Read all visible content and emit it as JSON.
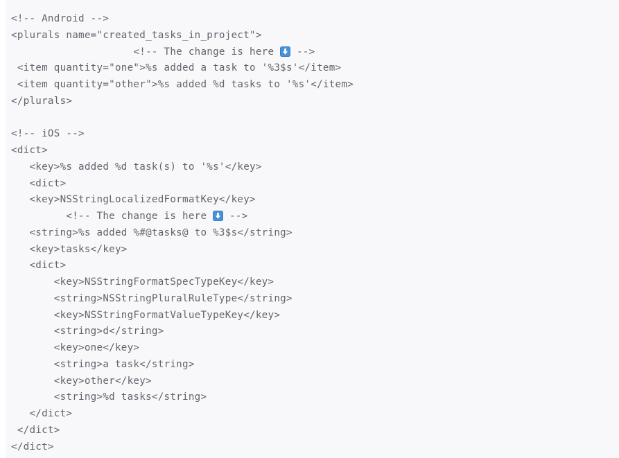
{
  "code": {
    "language": "xml",
    "background_color": "#f8f7fa",
    "text_color": "#60656d",
    "icon": {
      "name": "down-arrow-icon",
      "glyph": "⬇️",
      "background_color": "#4a90d9",
      "arrow_color": "#ffffff"
    },
    "lines": [
      {
        "id": "l1",
        "text": "<!-- Android -->"
      },
      {
        "id": "l2",
        "text": "<plurals name=\"created_tasks_in_project\">"
      },
      {
        "id": "l3",
        "before": "                    <!-- The change is here ",
        "icon": true,
        "after": " -->"
      },
      {
        "id": "l4",
        "text": " <item quantity=\"one\">%s added a task to '%3$s'</item>"
      },
      {
        "id": "l5",
        "text": " <item quantity=\"other\">%s added %d tasks to '%s'</item>"
      },
      {
        "id": "l6",
        "text": "</plurals>"
      },
      {
        "id": "l7",
        "text": ""
      },
      {
        "id": "l8",
        "text": "<!-- iOS -->"
      },
      {
        "id": "l9",
        "text": "<dict>"
      },
      {
        "id": "l10",
        "text": "   <key>%s added %d task(s) to '%s'</key>"
      },
      {
        "id": "l11",
        "text": "   <dict>"
      },
      {
        "id": "l12",
        "text": "   <key>NSStringLocalizedFormatKey</key>"
      },
      {
        "id": "l13",
        "before": "         <!-- The change is here ",
        "icon": true,
        "after": " -->"
      },
      {
        "id": "l14",
        "text": "   <string>%s added %#@tasks@ to %3$s</string>"
      },
      {
        "id": "l15",
        "text": "   <key>tasks</key>"
      },
      {
        "id": "l16",
        "text": "   <dict>"
      },
      {
        "id": "l17",
        "text": "       <key>NSStringFormatSpecTypeKey</key>"
      },
      {
        "id": "l18",
        "text": "       <string>NSStringPluralRuleType</string>"
      },
      {
        "id": "l19",
        "text": "       <key>NSStringFormatValueTypeKey</key>"
      },
      {
        "id": "l20",
        "text": "       <string>d</string>"
      },
      {
        "id": "l21",
        "text": "       <key>one</key>"
      },
      {
        "id": "l22",
        "text": "       <string>a task</string>"
      },
      {
        "id": "l23",
        "text": "       <key>other</key>"
      },
      {
        "id": "l24",
        "text": "       <string>%d tasks</string>"
      },
      {
        "id": "l25",
        "text": "   </dict>"
      },
      {
        "id": "l26",
        "text": " </dict>"
      },
      {
        "id": "l27",
        "text": "</dict>"
      }
    ]
  }
}
